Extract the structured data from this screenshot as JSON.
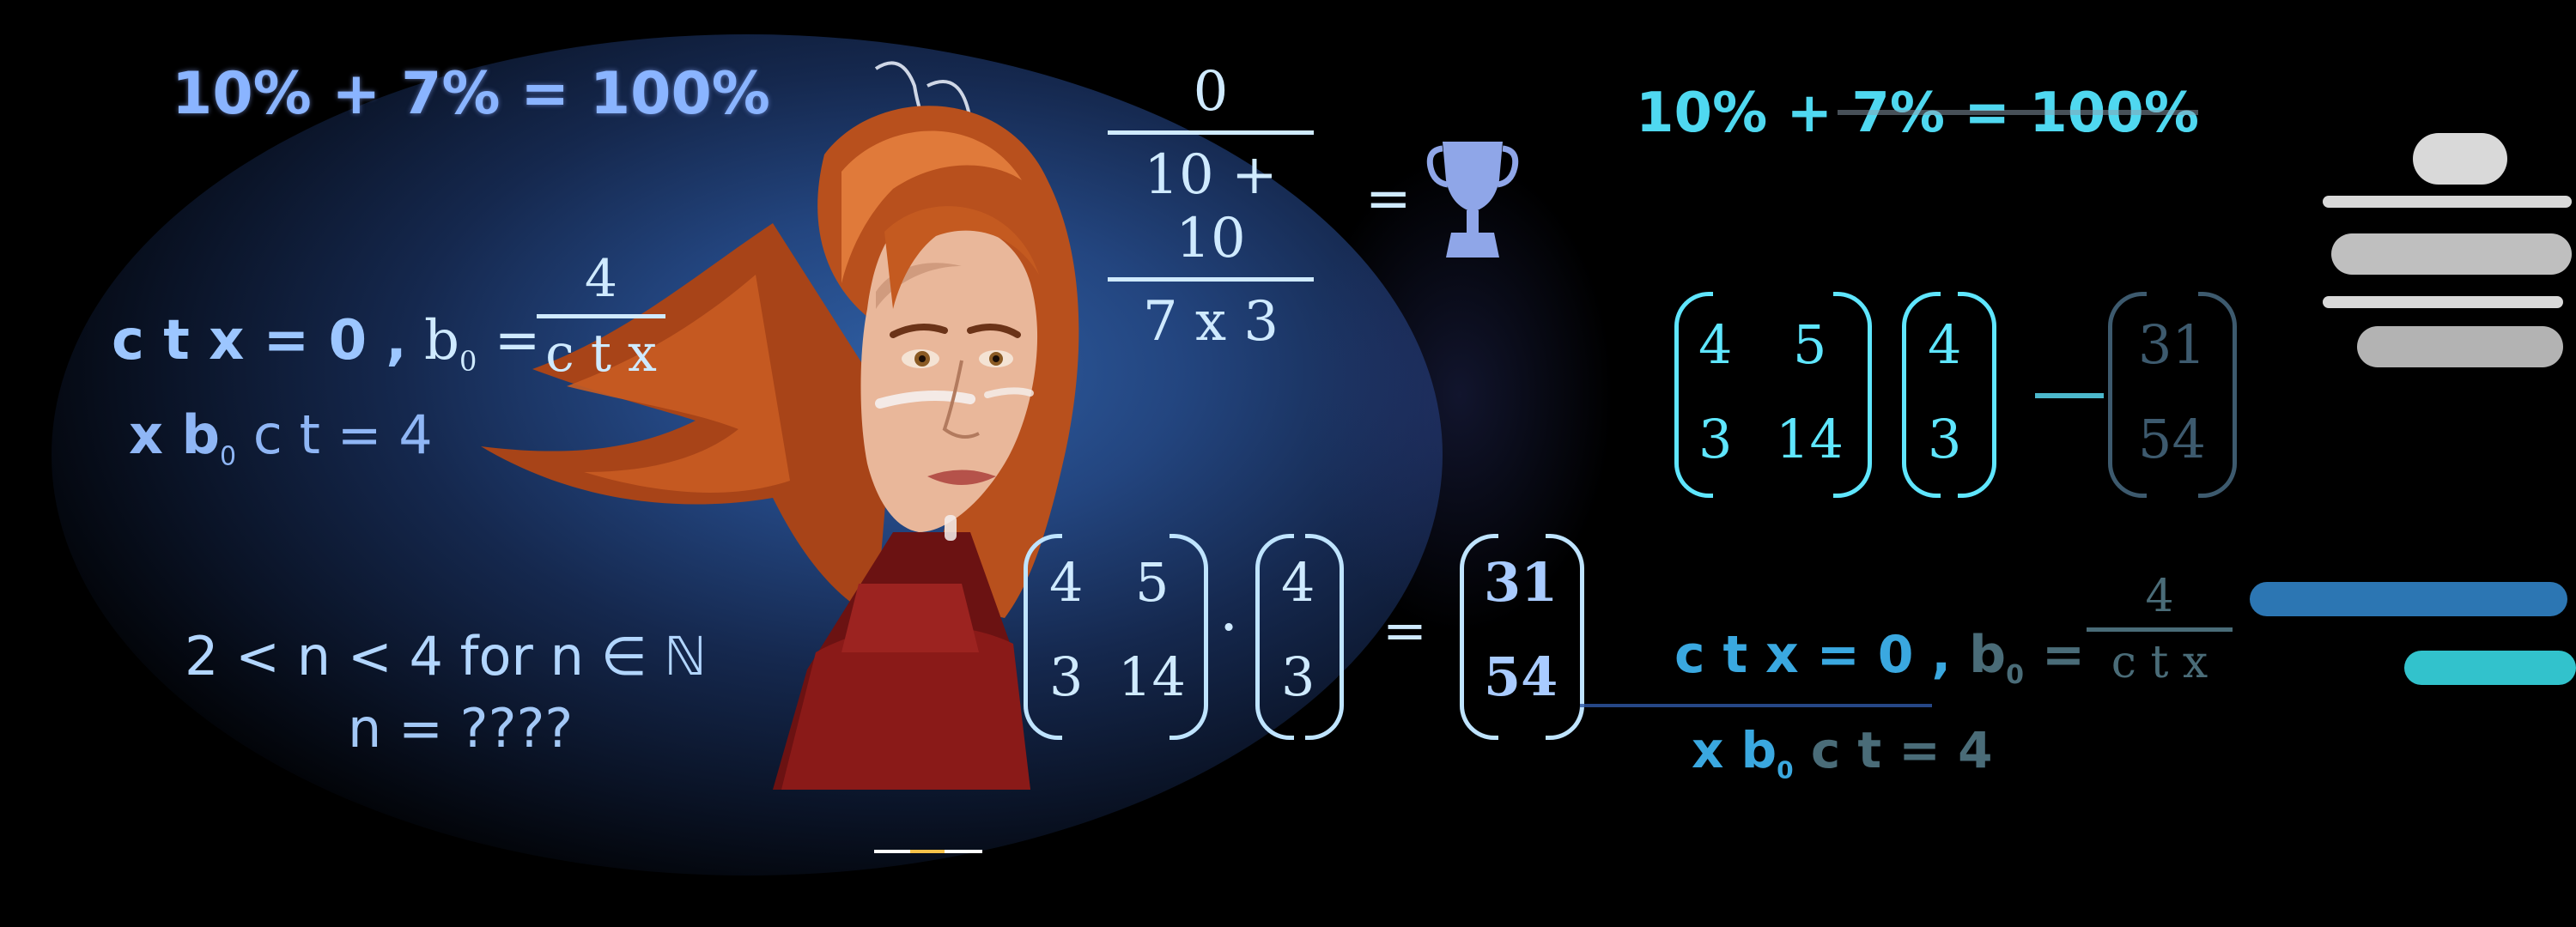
{
  "equations": {
    "percent": "10% + 7% = 100%",
    "ctx_left_a": "c t x = 0 ,",
    "b0": "b",
    "subscript_zero": "0",
    "equals": "=",
    "ctx_num": "4",
    "ctx_den": "c t x",
    "xbct_a": "x b",
    "xbct_b": "c t = 4",
    "range_line": "2 < n  < 4 for n ∈ ℕ",
    "n_question": "n = ????",
    "frac_top": "0",
    "frac_mid": "10 + 10",
    "frac_bot": "7 x 3",
    "matrix_a": [
      "4",
      "5",
      "3",
      "14"
    ],
    "vector_b": [
      "4",
      "3"
    ],
    "dot": "·",
    "result": [
      "31",
      "54"
    ]
  },
  "glitch": {
    "percent": "10% + 7% = 100%",
    "ctx_left_a": "c t x = 0 ,",
    "b0": "b",
    "subscript_zero": "0",
    "equals": "=",
    "ctx_num": "4",
    "ctx_den": "c t x",
    "xbct_a": "x b",
    "xbct_b": "c t = 4",
    "matrix_a": [
      "4",
      "5",
      "3",
      "14"
    ],
    "vector_b": [
      "4",
      "3"
    ],
    "result": [
      "31",
      "54"
    ]
  },
  "icons": {
    "trophy": "trophy-icon"
  },
  "colors": {
    "background": "#000000",
    "glow": "#2f5fa4",
    "equation_text": "#9cc6ff",
    "glitch_cyan": "#5fe6ff",
    "hair": "#c2521c"
  }
}
